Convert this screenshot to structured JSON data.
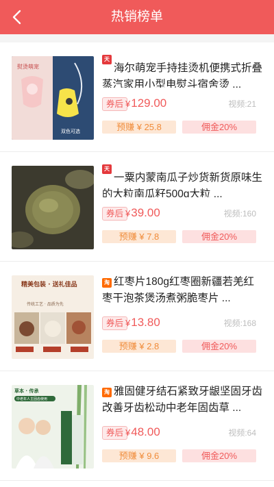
{
  "header": {
    "title": "热销榜单",
    "back_icon": "chevron-left-icon",
    "color": "#f05a5a"
  },
  "products": [
    {
      "shop": "天猫",
      "shop_type": "tmall",
      "title": "海尔萌宠手持挂烫机便携式折叠蒸汽家用小型电熨斗宿舍烫 ...",
      "coupon_label": "券后",
      "currency": "¥",
      "price": "129.00",
      "video": "视频:21",
      "earn": "预赚 ¥ 25.8",
      "commission": "佣金20%",
      "image_text_1": "熨烫萌宠",
      "image_text_2": "双色可选"
    },
    {
      "shop": "天猫",
      "shop_type": "tmall",
      "title": "一粟内蒙南瓜子炒货新货原味生的大粒南瓜籽500g大粒 ...",
      "coupon_label": "券后",
      "currency": "¥",
      "price": "39.00",
      "video": "视频:160",
      "earn": "预赚 ¥ 7.8",
      "commission": "佣金20%"
    },
    {
      "shop": "淘",
      "shop_type": "taobao",
      "title": "红枣片180g红枣圈新疆若羌红枣干泡茶煲汤煮粥脆枣片 ...",
      "coupon_label": "券后",
      "currency": "¥",
      "price": "13.80",
      "video": "视频:168",
      "earn": "预赚 ¥ 2.8",
      "commission": "佣金20%",
      "image_text_1": "精美包装 · 送礼佳品",
      "image_text_2": "传统工艺 · 品质为先"
    },
    {
      "shop": "淘",
      "shop_type": "taobao",
      "title": "雅固健牙结石紧致牙龈坚固牙齿改善牙齿松动中老年固齿草 ...",
      "coupon_label": "券后",
      "currency": "¥",
      "price": "48.00",
      "video": "视频:64",
      "earn": "预赚 ¥ 9.6",
      "commission": "佣金20%",
      "image_text_1": "草本 · 传承",
      "image_text_2": "中老年人主固齿使用"
    }
  ]
}
